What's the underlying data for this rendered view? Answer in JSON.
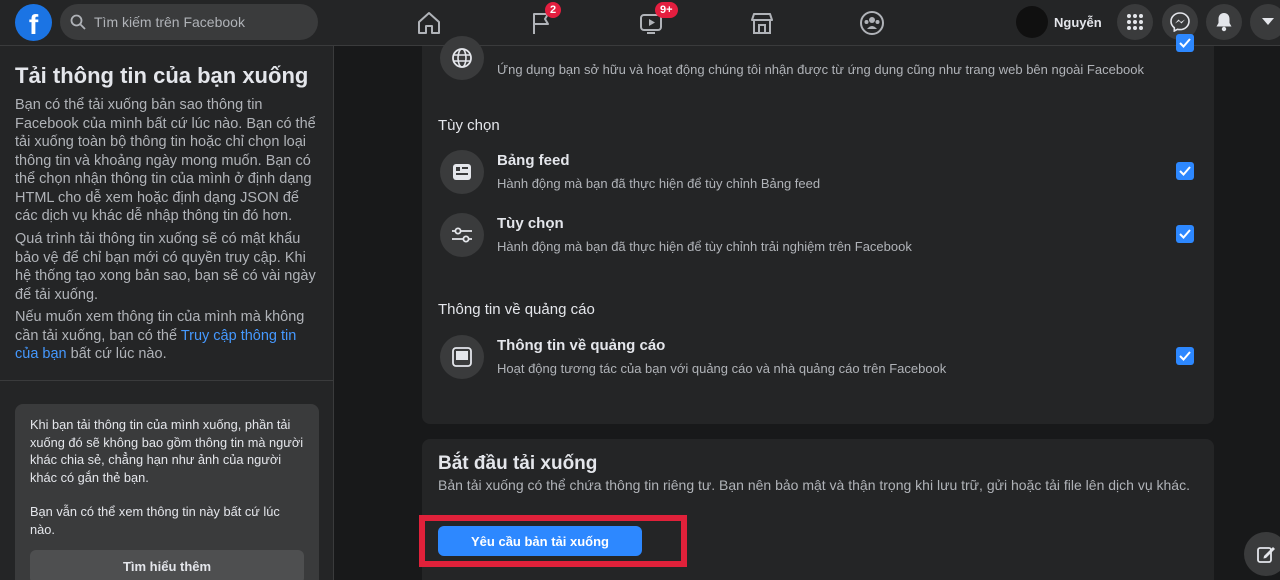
{
  "topbar": {
    "logo": "f",
    "search_placeholder": "Tìm kiếm trên Facebook",
    "badges": {
      "pages": "2",
      "watch": "9+"
    },
    "profile_name": "Nguyễn"
  },
  "left": {
    "title": "Tải thông tin của bạn xuống",
    "para1": "Bạn có thể tải xuống bản sao thông tin Facebook của mình bất cứ lúc nào. Bạn có thể tải xuống toàn bộ thông tin hoặc chỉ chọn loại thông tin và khoảng ngày mong muốn. Bạn có thể chọn nhận thông tin của mình ở định dạng HTML cho dễ xem hoặc định dạng JSON để các dịch vụ khác dễ nhập thông tin đó hơn.",
    "para2": "Quá trình tải thông tin xuống sẽ có mật khẩu bảo vệ để chỉ bạn mới có quyền truy cập. Khi hệ thống tạo xong bản sao, bạn sẽ có vài ngày để tải xuống.",
    "para3_before": "Nếu muốn xem thông tin của mình mà không cần tải xuống, bạn có thể ",
    "para3_link": "Truy cập thông tin của bạn",
    "para3_after": " bất cứ lúc nào.",
    "notice1": "Khi bạn tải thông tin của mình xuống, phần tải xuống đó sẽ không bao gồm thông tin mà người khác chia sẻ, chẳng hạn như ảnh của người khác có gắn thẻ bạn.",
    "notice2": "Bạn vẫn có thể xem thông tin này bất cứ lúc nào.",
    "learn_more": "Tìm hiểu thêm"
  },
  "main": {
    "top_row_desc": "Ứng dụng bạn sở hữu và hoạt động chúng tôi nhận được từ ứng dụng cũng như trang web bên ngoài Facebook",
    "section_options": "Tùy chọn",
    "feed_title": "Bảng feed",
    "feed_desc": "Hành động mà bạn đã thực hiện để tùy chỉnh Bảng feed",
    "pref_title": "Tùy chọn",
    "pref_desc": "Hành động mà bạn đã thực hiện để tùy chỉnh trải nghiệm trên Facebook",
    "section_ads": "Thông tin về quảng cáo",
    "ads_title": "Thông tin về quảng cáo",
    "ads_desc": "Hoạt động tương tác của bạn với quảng cáo và nhà quảng cáo trên Facebook",
    "start_title": "Bắt đầu tải xuống",
    "start_desc": "Bản tải xuống có thể chứa thông tin riêng tư. Bạn nên bảo mật và thận trọng khi lưu trữ, gửi hoặc tải file lên dịch vụ khác.",
    "request_button": "Yêu cầu bản tải xuống"
  },
  "colors": {
    "accent": "#2d88ff",
    "highlight": "#e0213a",
    "badge": "#e41e3f"
  }
}
